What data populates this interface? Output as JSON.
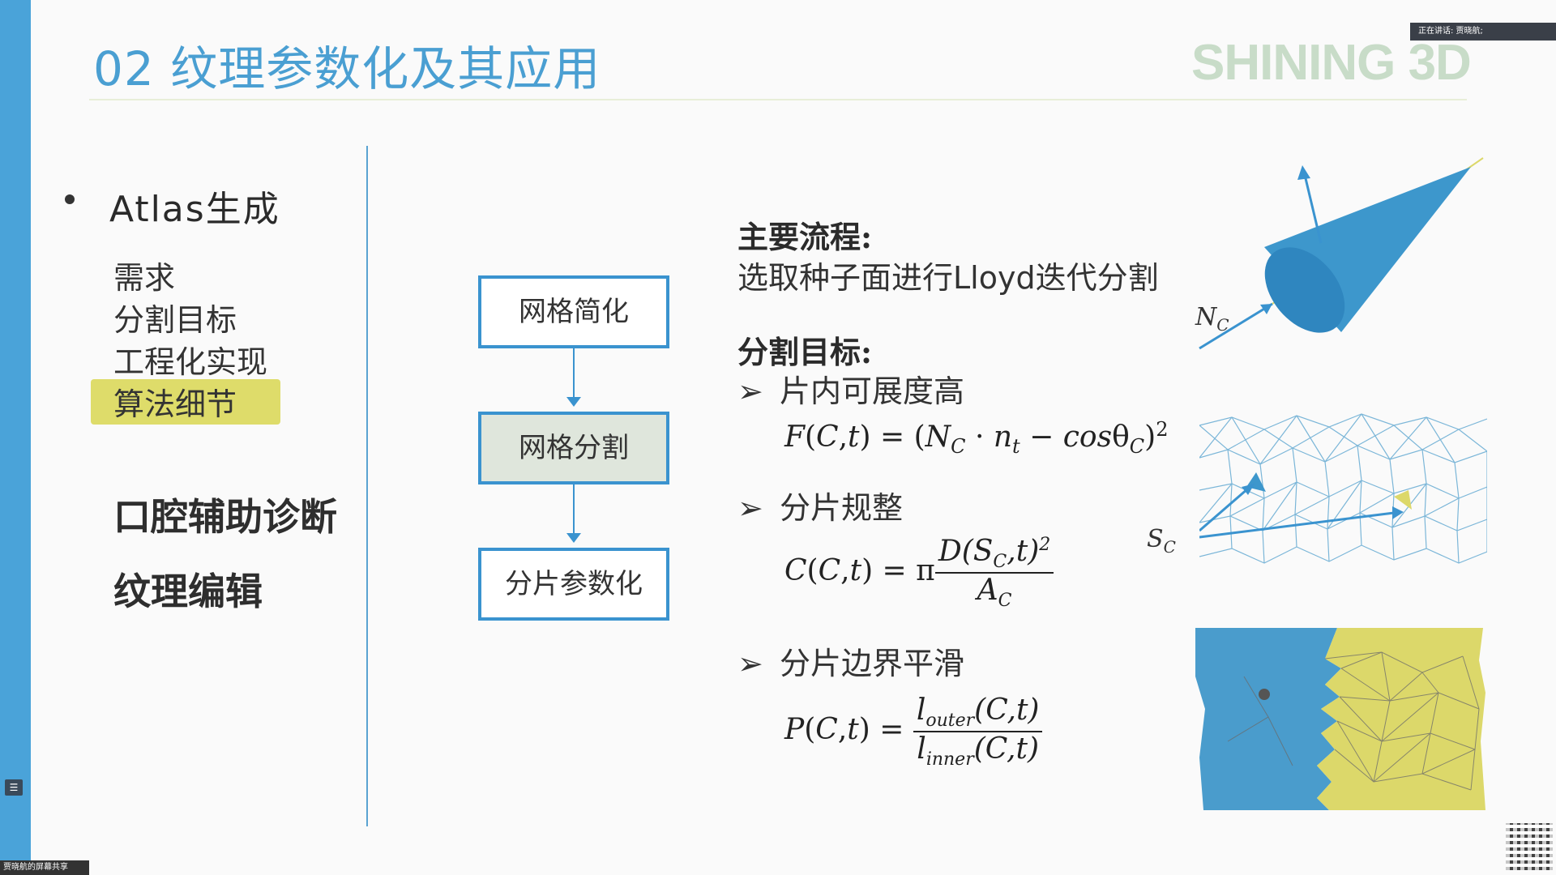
{
  "header": {
    "title": "02 纹理参数化及其应用",
    "logo": "SHINING 3D",
    "speaker_status": "正在讲话: 贾晓航;"
  },
  "left_panel": {
    "heading": "Atlas生成",
    "sub_items": [
      "需求",
      "分割目标",
      "工程化实现",
      "算法细节"
    ],
    "active_sub_item": "算法细节",
    "other_topics": [
      "口腔辅助诊断",
      "纹理编辑"
    ]
  },
  "flowchart": {
    "steps": [
      "网格简化",
      "网格分割",
      "分片参数化"
    ],
    "active_step": "网格分割"
  },
  "content": {
    "process_heading": "主要流程:",
    "process_text": "选取种子面进行Lloyd迭代分割",
    "goal_heading": "分割目标:",
    "goals": [
      {
        "label": "片内可展度高",
        "formula": "F(C,t) = (N_C · n_t − cosθ_C)²"
      },
      {
        "label": "分片规整",
        "formula": "C(C,t) = π D(S_C,t)² / A_C"
      },
      {
        "label": "分片边界平滑",
        "formula": "P(C,t) = l_outer(C,t) / l_inner(C,t)"
      }
    ]
  },
  "figure_labels": {
    "cone_label": "N",
    "cone_label_sub": "C",
    "mesh_label": "S",
    "mesh_label_sub": "C"
  },
  "bottom": {
    "share_text": "贾晓航的屏幕共享"
  },
  "colors": {
    "accent_blue": "#4aa3d9",
    "highlight_yellow": "#dedc6a",
    "patch_blue": "#4a9ccc",
    "patch_yellow": "#dcd86a"
  }
}
